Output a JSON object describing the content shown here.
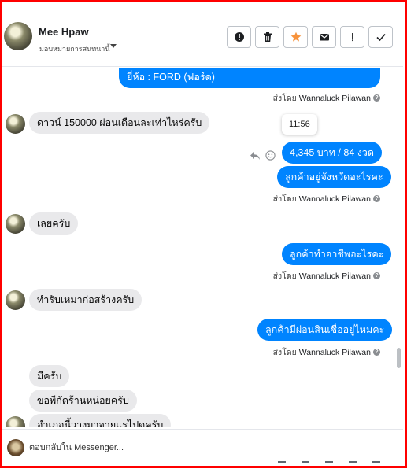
{
  "header": {
    "contact_name": "Mee Hpaw",
    "assign_label": "มอบหมายการสนทนานี้",
    "actions": [
      {
        "name": "spam-button",
        "icon": "alert-circle-icon"
      },
      {
        "name": "delete-button",
        "icon": "trash-icon"
      },
      {
        "name": "star-button",
        "icon": "star-icon",
        "color": "#f7923b"
      },
      {
        "name": "mark-unread-button",
        "icon": "envelope-icon"
      },
      {
        "name": "follow-up-button",
        "icon": "exclamation-icon"
      },
      {
        "name": "mark-done-button",
        "icon": "check-icon"
      }
    ]
  },
  "messages": [
    {
      "side": "out",
      "text": "ยี่ห้อ : FORD (ฟอร์ด)"
    },
    {
      "side": "sent_by",
      "prefix": "ส่งโดย",
      "name": "Wannaluck Pilawan"
    },
    {
      "side": "in",
      "text": "ดาวน์ 150000 ผ่อนเดือนละเท่าไหร่ครับ"
    },
    {
      "side": "tooltip",
      "text": "11:56"
    },
    {
      "side": "out",
      "text": "4,345 บาท   / 84 งวด"
    },
    {
      "side": "out",
      "text": "ลูกค้าอยู่จังหวัดอะไรคะ"
    },
    {
      "side": "sent_by",
      "prefix": "ส่งโดย",
      "name": "Wannaluck Pilawan"
    },
    {
      "side": "in",
      "text": "เลยครับ"
    },
    {
      "side": "out",
      "text": "ลูกค้าทำอาชีพอะไรคะ"
    },
    {
      "side": "sent_by",
      "prefix": "ส่งโดย",
      "name": "Wannaluck Pilawan"
    },
    {
      "side": "in",
      "text": "ทำรับเหมาก่อสร้างครับ"
    },
    {
      "side": "out",
      "text": "ลูกค้ามีผ่อนสินเชื่ออยู่ไหมคะ"
    },
    {
      "side": "sent_by",
      "prefix": "ส่งโดย",
      "name": "Wannaluck Pilawan"
    },
    {
      "side": "in",
      "text": "มีครับ"
    },
    {
      "side": "in",
      "text": "ขอพีกัดร้านหน่อยครับ"
    },
    {
      "side": "in",
      "text": "อำเภอนี้วางมาจายแรไปดครับ"
    }
  ],
  "footer": {
    "reply_placeholder": "ตอบกลับใน Messenger..."
  },
  "colors": {
    "outgoing_bubble": "#0084ff",
    "incoming_bubble": "#e9e9eb",
    "frame": "#ff0000"
  }
}
